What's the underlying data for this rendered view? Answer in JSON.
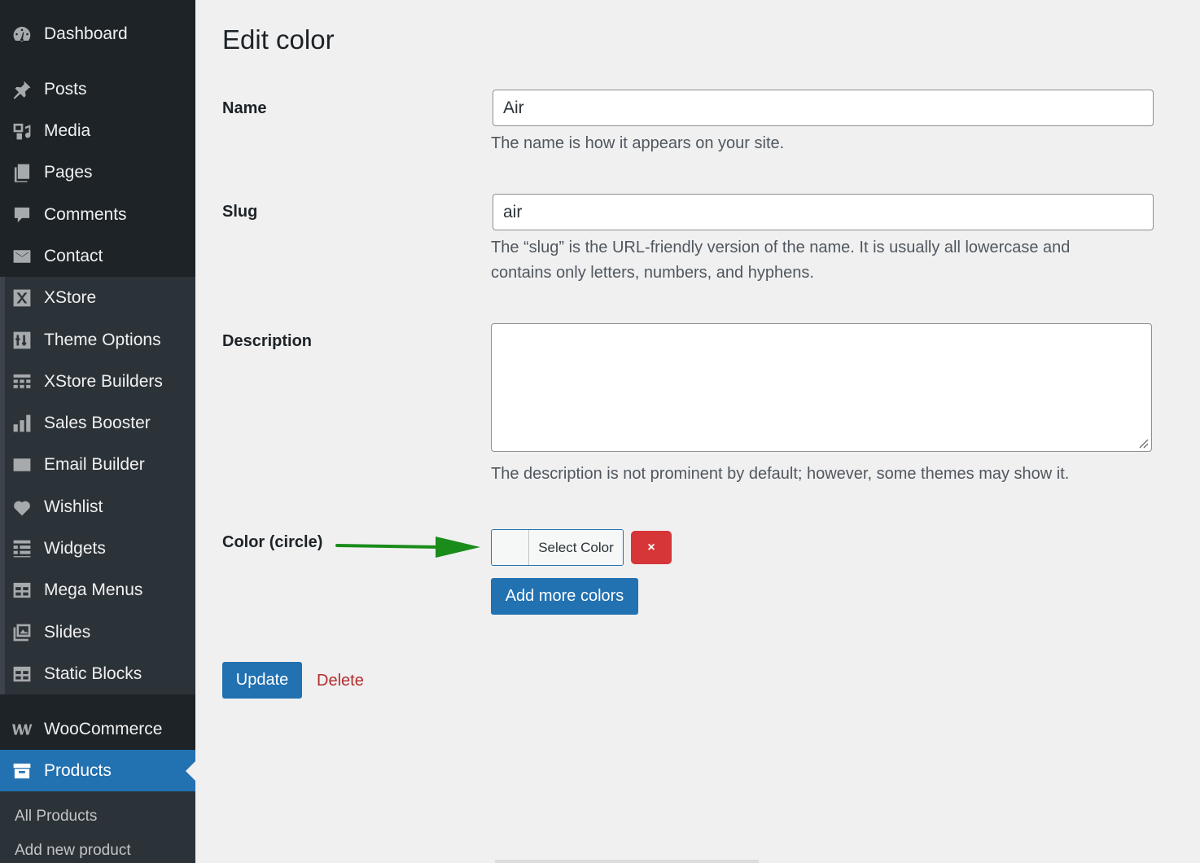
{
  "sidebar": {
    "items": [
      {
        "label": "Dashboard",
        "icon": "dashboard-icon"
      },
      {
        "label": "Posts",
        "icon": "pin-icon"
      },
      {
        "label": "Media",
        "icon": "media-icon"
      },
      {
        "label": "Pages",
        "icon": "pages-icon"
      },
      {
        "label": "Comments",
        "icon": "comment-icon"
      },
      {
        "label": "Contact",
        "icon": "envelope-icon"
      },
      {
        "label": "XStore",
        "icon": "xstore-icon"
      },
      {
        "label": "Theme Options",
        "icon": "sliders-icon"
      },
      {
        "label": "XStore Builders",
        "icon": "grid-icon"
      },
      {
        "label": "Sales Booster",
        "icon": "bar-chart-icon"
      },
      {
        "label": "Email Builder",
        "icon": "email-icon"
      },
      {
        "label": "Wishlist",
        "icon": "heart-icon"
      },
      {
        "label": "Widgets",
        "icon": "widgets-icon"
      },
      {
        "label": "Mega Menus",
        "icon": "table-icon"
      },
      {
        "label": "Slides",
        "icon": "slides-icon"
      },
      {
        "label": "Static Blocks",
        "icon": "table-icon"
      },
      {
        "label": "WooCommerce",
        "icon": "woo-icon"
      },
      {
        "label": "Products",
        "icon": "archive-icon"
      }
    ],
    "submenu": [
      {
        "label": "All Products"
      },
      {
        "label": "Add new product"
      }
    ]
  },
  "main": {
    "title": "Edit color",
    "name": {
      "label": "Name",
      "value": "Air",
      "help": "The name is how it appears on your site."
    },
    "slug": {
      "label": "Slug",
      "value": "air",
      "help": "The “slug” is the URL-friendly version of the name. It is usually all lowercase and contains only letters, numbers, and hyphens."
    },
    "description": {
      "label": "Description",
      "value": "",
      "help": "The description is not prominent by default; however, some themes may show it."
    },
    "color": {
      "label": "Color (circle)",
      "select_label": "Select Color",
      "remove_label": "×",
      "add_more_label": "Add more colors"
    },
    "update_label": "Update",
    "delete_label": "Delete"
  },
  "colors": {
    "sidebar_bg": "#1d2327",
    "accent": "#2271b1",
    "danger": "#d63638",
    "arrow": "#1a8c1a"
  }
}
